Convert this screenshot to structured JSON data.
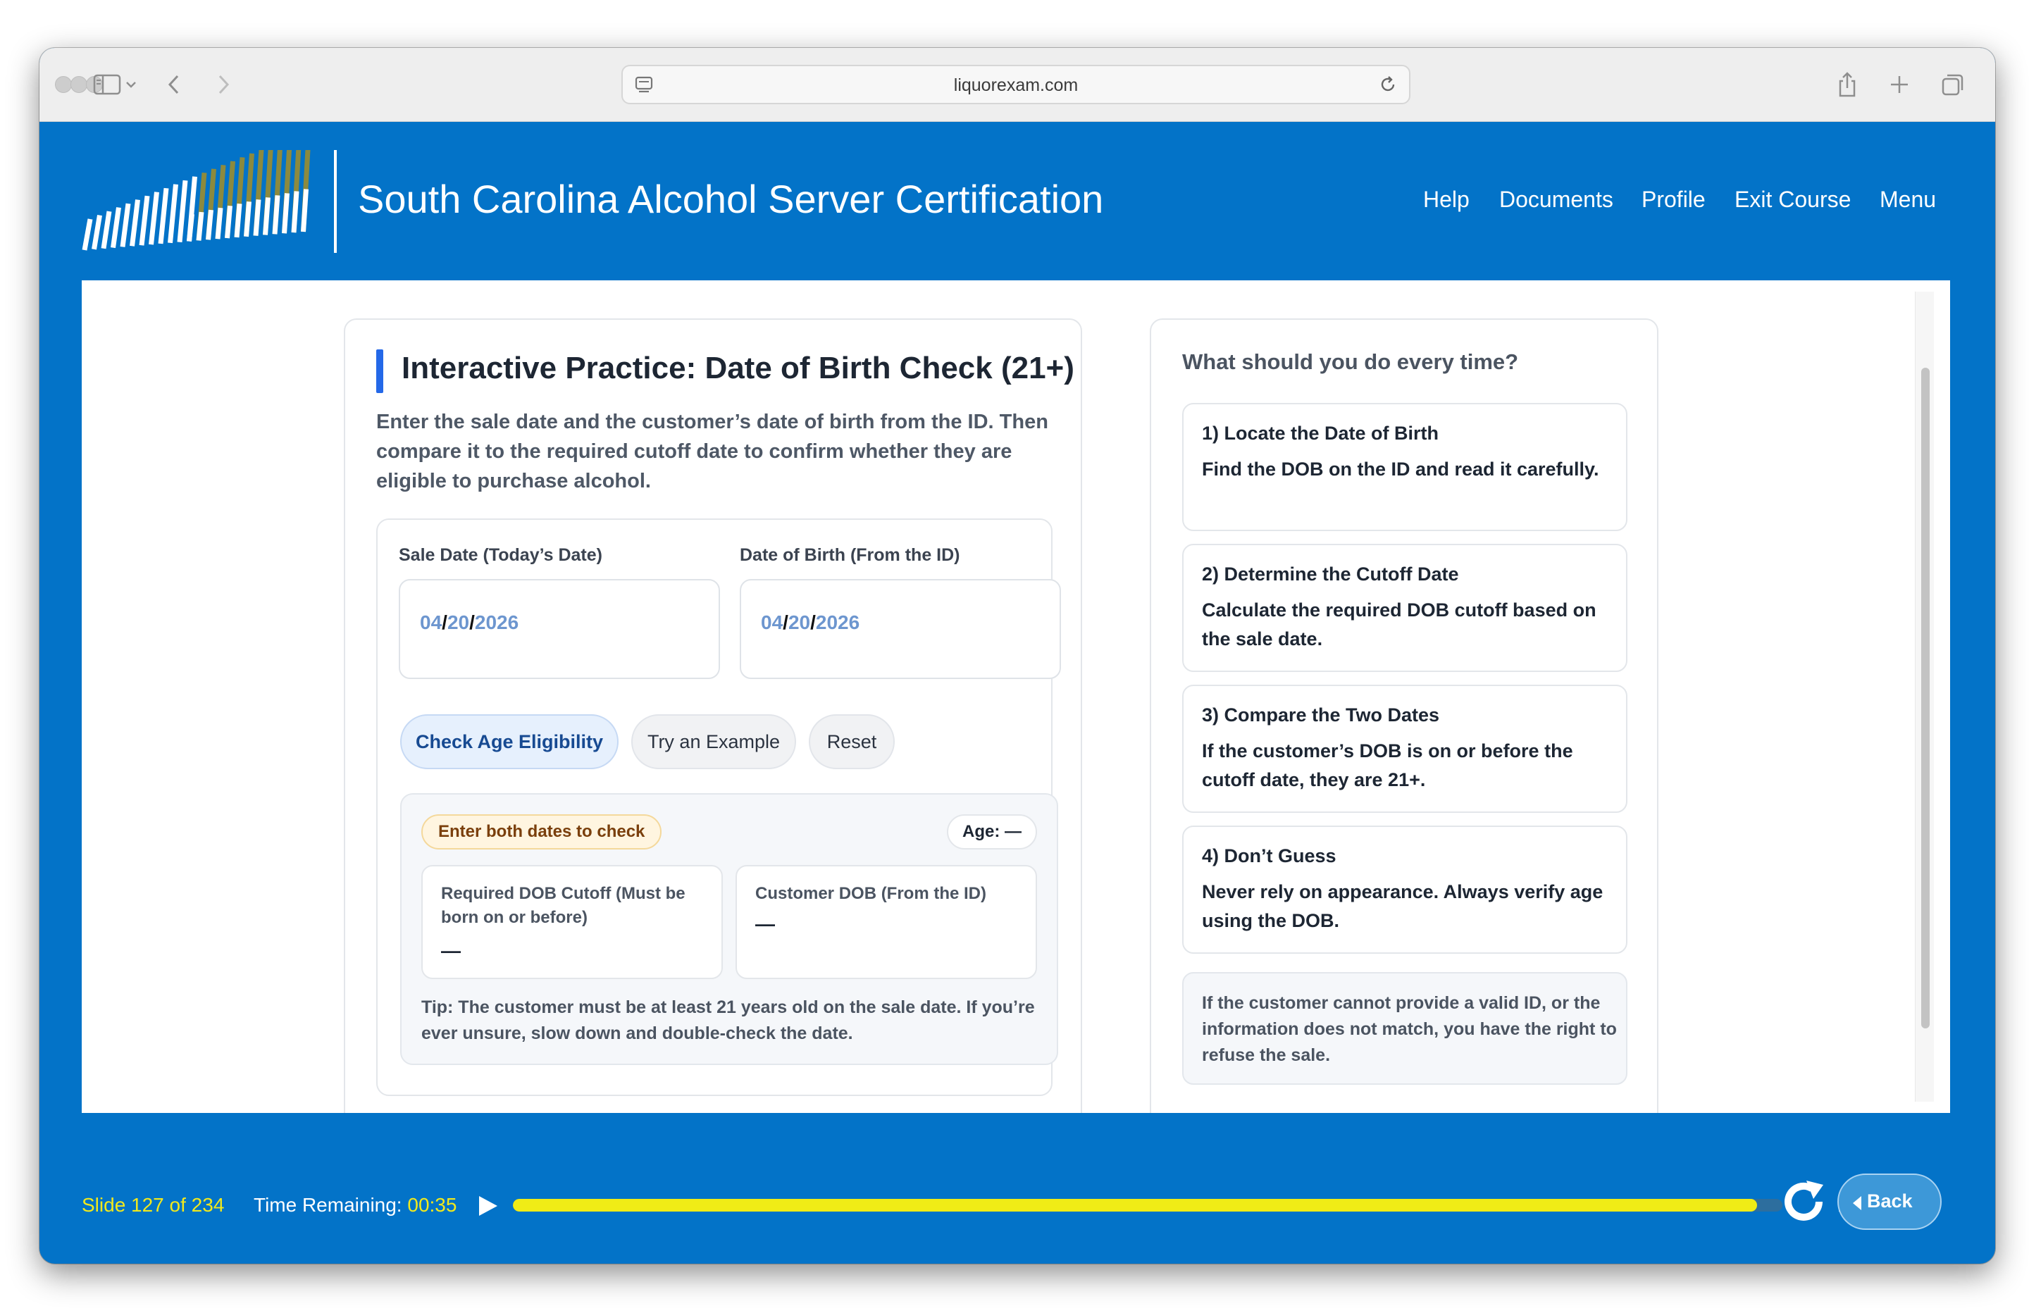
{
  "browser": {
    "url": "liquorexam.com"
  },
  "course": {
    "title": "South Carolina Alcohol Server Certification",
    "nav": [
      "Help",
      "Documents",
      "Profile",
      "Exit Course",
      "Menu"
    ]
  },
  "practice": {
    "heading": "Interactive Practice: Date of Birth Check (21+)",
    "intro": "Enter the sale date and the customer’s date of birth from the ID. Then compare it to the required cutoff date to confirm whether they are eligible to purchase alcohol.",
    "sale_date": {
      "label": "Sale Date (Today’s Date)",
      "month": "04",
      "day": "20",
      "year": "2026"
    },
    "dob": {
      "label": "Date of Birth (From the ID)",
      "month": "04",
      "day": "20",
      "year": "2026"
    },
    "buttons": {
      "check": "Check Age Eligibility",
      "example": "Try an Example",
      "reset": "Reset"
    },
    "result": {
      "status": "Enter both dates to check",
      "age": "Age: —",
      "cutoff_label": "Required DOB Cutoff (Must be born on or before)",
      "cutoff_value": "—",
      "customer_label": "Customer DOB (From the ID)",
      "customer_value": "—",
      "tip": "Tip: The customer must be at least 21 years old on the sale date. If you’re ever unsure, slow down and double-check the date."
    }
  },
  "guide": {
    "title": "What should you do every time?",
    "steps": [
      {
        "title": "1) Locate the Date of Birth",
        "body": "Find the DOB on the ID and read it carefully."
      },
      {
        "title": "2) Determine the Cutoff Date",
        "body": "Calculate the required DOB cutoff based on the sale date."
      },
      {
        "title": "3) Compare the Two Dates",
        "body": "If the customer’s DOB is on or before the cutoff date, they are 21+."
      },
      {
        "title": "4) Don’t Guess",
        "body": "Never rely on appearance. Always verify age using the DOB."
      }
    ],
    "note": "If the customer cannot provide a valid ID, or the information does not match, you have the right to refuse the sale."
  },
  "player": {
    "slide": "Slide 127 of 234",
    "time_label": "Time Remaining:",
    "time_value": "00:35",
    "progress": 0.98,
    "back": "Back"
  },
  "colors": {
    "brand_blue": "#0373c8",
    "progress_yellow": "#f0ec16",
    "accent": "#2468e8"
  },
  "icons": [
    "sidebar-icon",
    "chevron-down-icon",
    "back-arrow-icon",
    "forward-arrow-icon",
    "site-settings-icon",
    "reload-icon",
    "share-icon",
    "new-tab-icon",
    "tabs-overview-icon",
    "play-icon",
    "replay-icon",
    "volume-icon"
  ]
}
